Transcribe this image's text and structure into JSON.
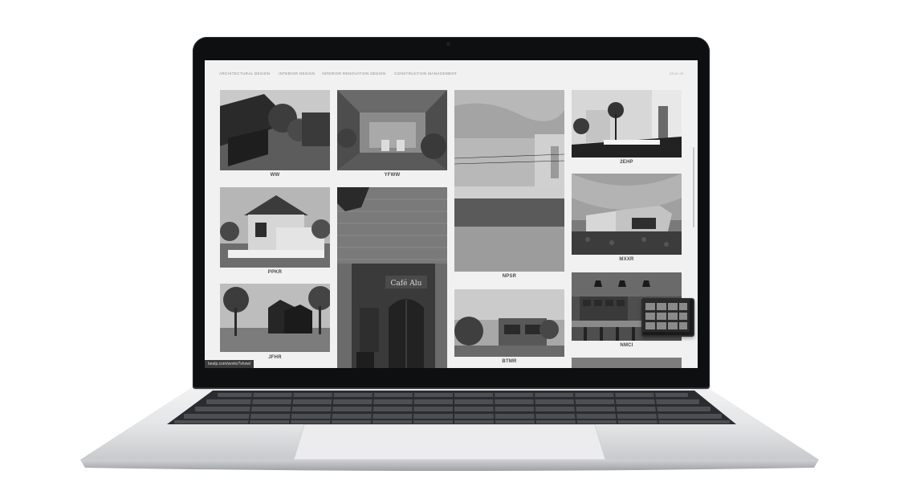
{
  "nav": {
    "items": [
      "ARCHITECTURAL DESIGN",
      "INTERIOR DESIGN",
      "INTERIOR RENOVATION DESIGN",
      "CONSTRUCTION MANAGEMENT"
    ],
    "show_all": "Show all"
  },
  "projects": [
    {
      "name": "WW"
    },
    {
      "name": "YFWW"
    },
    {
      "name": "NPSR"
    },
    {
      "name": "2EHP"
    },
    {
      "name": "PPKR"
    },
    {
      "name": "MXXR"
    },
    {
      "name": "NMCI"
    },
    {
      "name": "JFHR"
    },
    {
      "name": "BTMR"
    }
  ],
  "status_url": "bealp.com/works?show/",
  "cafe_sign": "Café Alu",
  "colors": {
    "page_bg": "#f1f1f1",
    "label": "#4a4a4a",
    "nav": "#8b8b8b",
    "bezel": "#0e0f11",
    "aluminum": "#d7d8db"
  },
  "icons": {
    "camera": "camera-dot-icon"
  }
}
